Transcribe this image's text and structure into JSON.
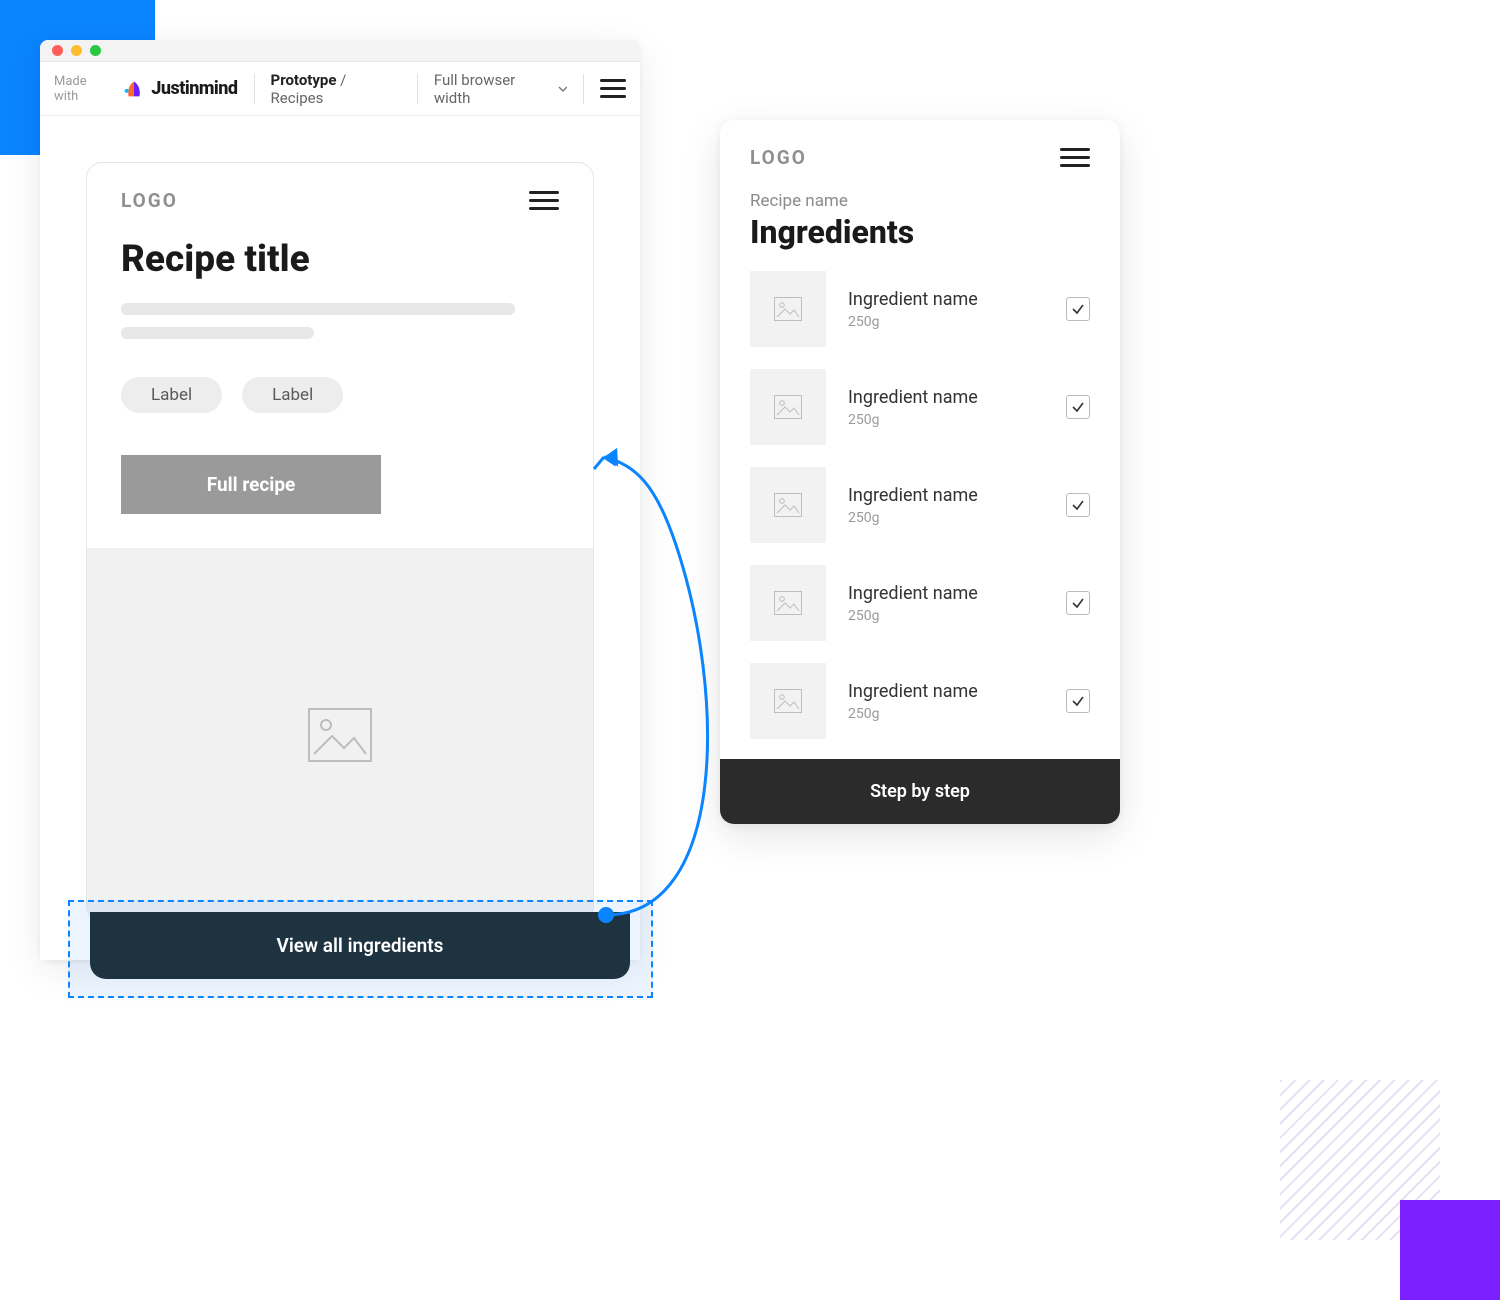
{
  "toolbar": {
    "made_with": "Made with",
    "brand": "Justinmind",
    "crumb_strong": "Prototype",
    "crumb_rest": " / Recipes",
    "zoom_label": "Full browser width"
  },
  "recipe": {
    "logo": "LOGO",
    "title": "Recipe title",
    "labels": [
      "Label",
      "Label"
    ],
    "cta": "Full recipe",
    "view_all": "View all ingredients"
  },
  "ingredients_panel": {
    "logo": "LOGO",
    "subtitle": "Recipe name",
    "title": "Ingredients",
    "items": [
      {
        "name": "Ingredient name",
        "amount": "250g"
      },
      {
        "name": "Ingredient name",
        "amount": "250g"
      },
      {
        "name": "Ingredient name",
        "amount": "250g"
      },
      {
        "name": "Ingredient name",
        "amount": "250g"
      },
      {
        "name": "Ingredient name",
        "amount": "250g"
      }
    ],
    "step_button": "Step by step"
  }
}
